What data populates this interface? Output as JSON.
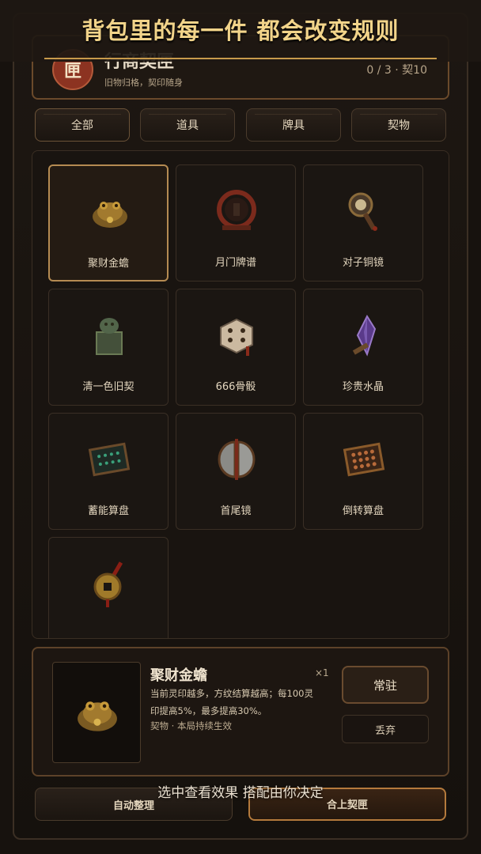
{
  "banner": {
    "text": "背包里的每一件  都会改变规则"
  },
  "header": {
    "seal_char": "匣",
    "title": "行商契匣",
    "subtitle": "旧物归格，契印随身",
    "count": "0 / 3 · 契10"
  },
  "tabs": [
    {
      "label": "全部"
    },
    {
      "label": "道具"
    },
    {
      "label": "牌具"
    },
    {
      "label": "契物"
    }
  ],
  "items": [
    {
      "name": "聚财金蟾",
      "icon": "golden-toad-icon",
      "selected": true
    },
    {
      "name": "月门牌谱",
      "icon": "moon-gate-icon"
    },
    {
      "name": "对子铜镜",
      "icon": "bronze-mirror-icon"
    },
    {
      "name": "清一色旧契",
      "icon": "jade-seal-icon"
    },
    {
      "name": "666骨骰",
      "icon": "bone-dice-icon"
    },
    {
      "name": "珍贵水晶",
      "icon": "crystal-icon"
    },
    {
      "name": "蓄能算盘",
      "icon": "abacus-icon"
    },
    {
      "name": "首尾镜",
      "icon": "split-mirror-icon"
    },
    {
      "name": "倒转算盘",
      "icon": "abacus-icon"
    },
    {
      "name": "",
      "icon": "coin-charm-icon"
    }
  ],
  "detail": {
    "name": "聚财金蟾",
    "qty": "×1",
    "desc_line1": "当前灵印越多，方纹结算越高；每100灵",
    "desc_line2": "印提高5%，最多提高30%。",
    "tag": "契物 · 本局持续生效",
    "resident_label": "常驻",
    "discard_label": "丢弃"
  },
  "bottom": {
    "auto_sort_label": "自动整理",
    "close_label": "合上契匣",
    "caption": "选中查看效果  搭配由你决定"
  },
  "colors": {
    "accent": "#c89a4b",
    "selected_border": "#b58b52",
    "banner_text": "#f2d48a"
  }
}
